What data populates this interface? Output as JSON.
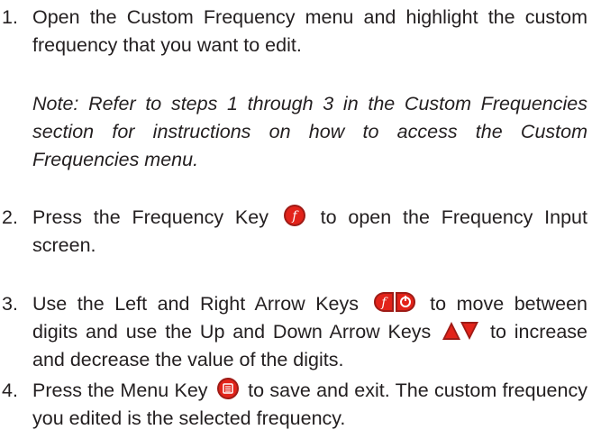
{
  "steps": [
    {
      "number": "1.",
      "text": "Open the Custom Frequency menu and highlight the custom frequency that you want to edit."
    },
    {
      "number": "2.",
      "text_before": "Press the Frequency Key",
      "text_after": "to open the Frequency Input screen.",
      "icons": [
        "frequency-key-icon"
      ]
    },
    {
      "number": "3.",
      "text_a": "Use the Left and Right Arrow Keys",
      "text_b": "to move between digits and use the Up and Down Arrow Keys",
      "text_c": "to increase and decrease the value of the digits.",
      "icons": [
        "left-arrow-key-icon",
        "right-arrow-key-icon",
        "up-arrow-key-icon",
        "down-arrow-key-icon"
      ]
    },
    {
      "number": "4.",
      "text_before": "Press the Menu Key",
      "text_after": "to save and exit. The custom frequency you edited is the selected frequency.",
      "icons": [
        "menu-key-icon"
      ]
    }
  ],
  "note": "Note: Refer to steps 1 through 3 in the Custom Frequencies section for instructions on how to access the Custom Frequencies menu.",
  "colors": {
    "text": "#231f20",
    "key_red": "#e2231a",
    "key_dark_red": "#9e1b16"
  }
}
